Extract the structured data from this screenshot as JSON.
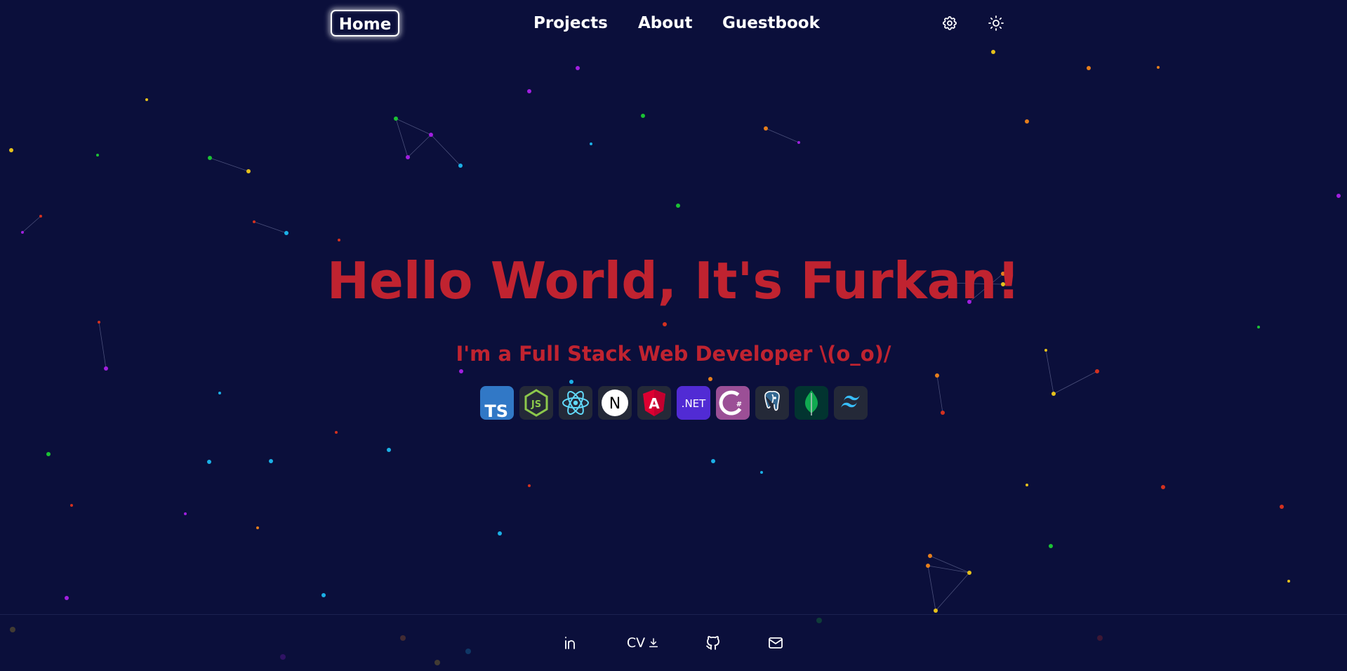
{
  "nav": {
    "home_label": "Home",
    "projects_label": "Projects",
    "about_label": "About",
    "guestbook_label": "Guestbook",
    "settings_icon": "gear-icon",
    "theme_icon": "sun-icon"
  },
  "hero": {
    "title": "Hello World, It's Furkan!",
    "subtitle": "I'm a Full Stack Web Developer \\(o_o)/"
  },
  "tech_stack": [
    {
      "name": "TypeScript",
      "label": "TS"
    },
    {
      "name": "Node.js",
      "label": "JS"
    },
    {
      "name": "React",
      "label": ""
    },
    {
      "name": "Next.js",
      "label": "N"
    },
    {
      "name": "Angular",
      "label": "A"
    },
    {
      "name": ".NET",
      "label": ".NET"
    },
    {
      "name": "C#",
      "label": "C#"
    },
    {
      "name": "PostgreSQL",
      "label": ""
    },
    {
      "name": "MongoDB",
      "label": ""
    },
    {
      "name": "Tailwind CSS",
      "label": ""
    }
  ],
  "footer": {
    "linkedin_icon": "linkedin-icon",
    "cv_label": "CV",
    "cv_icon": "download-icon",
    "github_icon": "github-icon",
    "mail_icon": "mail-icon"
  },
  "colors": {
    "background": "#0b0f3b",
    "accent": "#c02330",
    "text": "#ffffff",
    "particles": [
      "#e6c11b",
      "#e67e1b",
      "#a11fe0",
      "#1bb0e6",
      "#1bc234",
      "#d4311f"
    ]
  }
}
